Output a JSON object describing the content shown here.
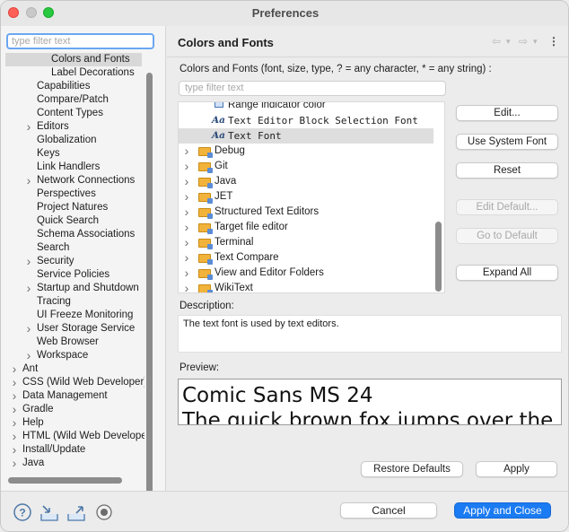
{
  "window": {
    "title": "Preferences"
  },
  "sidebar": {
    "filter_placeholder": "type filter text",
    "items": [
      {
        "label": "Colors and Fonts",
        "level": 3,
        "expandable": false,
        "selected": true
      },
      {
        "label": "Label Decorations",
        "level": 3,
        "expandable": false
      },
      {
        "label": "Capabilities",
        "level": 2,
        "expandable": false
      },
      {
        "label": "Compare/Patch",
        "level": 2,
        "expandable": false
      },
      {
        "label": "Content Types",
        "level": 2,
        "expandable": false
      },
      {
        "label": "Editors",
        "level": 2,
        "expandable": true
      },
      {
        "label": "Globalization",
        "level": 2,
        "expandable": false
      },
      {
        "label": "Keys",
        "level": 2,
        "expandable": false
      },
      {
        "label": "Link Handlers",
        "level": 2,
        "expandable": false
      },
      {
        "label": "Network Connections",
        "level": 2,
        "expandable": true
      },
      {
        "label": "Perspectives",
        "level": 2,
        "expandable": false
      },
      {
        "label": "Project Natures",
        "level": 2,
        "expandable": false
      },
      {
        "label": "Quick Search",
        "level": 2,
        "expandable": false
      },
      {
        "label": "Schema Associations",
        "level": 2,
        "expandable": false
      },
      {
        "label": "Search",
        "level": 2,
        "expandable": false
      },
      {
        "label": "Security",
        "level": 2,
        "expandable": true
      },
      {
        "label": "Service Policies",
        "level": 2,
        "expandable": false
      },
      {
        "label": "Startup and Shutdown",
        "level": 2,
        "expandable": true
      },
      {
        "label": "Tracing",
        "level": 2,
        "expandable": false
      },
      {
        "label": "UI Freeze Monitoring",
        "level": 2,
        "expandable": false
      },
      {
        "label": "User Storage Service",
        "level": 2,
        "expandable": true
      },
      {
        "label": "Web Browser",
        "level": 2,
        "expandable": false
      },
      {
        "label": "Workspace",
        "level": 2,
        "expandable": true
      },
      {
        "label": "Ant",
        "level": 1,
        "expandable": true
      },
      {
        "label": "CSS (Wild Web Developer)",
        "level": 1,
        "expandable": true
      },
      {
        "label": "Data Management",
        "level": 1,
        "expandable": true
      },
      {
        "label": "Gradle",
        "level": 1,
        "expandable": true
      },
      {
        "label": "Help",
        "level": 1,
        "expandable": true
      },
      {
        "label": "HTML (Wild Web Developer)",
        "level": 1,
        "expandable": true
      },
      {
        "label": "Install/Update",
        "level": 1,
        "expandable": true
      },
      {
        "label": "Java",
        "level": 1,
        "expandable": true
      }
    ]
  },
  "main": {
    "title": "Colors and Fonts",
    "nav": {
      "back": "⇦",
      "back_menu": "▾",
      "forward": "⇨",
      "forward_menu": "▾",
      "more": "⋮"
    },
    "instructions": "Colors and Fonts (font, size, type, ? = any character, * = any string) :",
    "filter_placeholder": "type filter text",
    "font_items": [
      {
        "label": "Range indicator color",
        "kind": "color"
      },
      {
        "label": "Text Editor Block Selection Font",
        "kind": "font"
      },
      {
        "label": "Text Font",
        "kind": "font",
        "selected": true
      },
      {
        "label": "Debug",
        "kind": "category"
      },
      {
        "label": "Git",
        "kind": "category"
      },
      {
        "label": "Java",
        "kind": "category"
      },
      {
        "label": "JET",
        "kind": "category"
      },
      {
        "label": "Structured Text Editors",
        "kind": "category"
      },
      {
        "label": "Target file editor",
        "kind": "category"
      },
      {
        "label": "Terminal",
        "kind": "category"
      },
      {
        "label": "Text Compare",
        "kind": "category"
      },
      {
        "label": "View and Editor Folders",
        "kind": "category"
      },
      {
        "label": "WikiText",
        "kind": "category"
      }
    ],
    "font_glyph": "Aa",
    "buttons": {
      "edit": "Edit...",
      "use_system_font": "Use System Font",
      "reset": "Reset",
      "edit_default": "Edit Default...",
      "go_to_default": "Go to Default",
      "expand_all": "Expand All"
    },
    "description_label": "Description:",
    "description_text": "The text font is used by text editors.",
    "preview_label": "Preview:",
    "preview_line1": "Comic Sans MS 24",
    "preview_line2": "The quick brown fox jumps over the lazy dog.",
    "restore_defaults": "Restore Defaults",
    "apply": "Apply"
  },
  "footer": {
    "cancel": "Cancel",
    "apply_and_close": "Apply and Close",
    "icons": [
      "help-icon",
      "import-icon",
      "export-icon",
      "record-icon"
    ]
  },
  "colors": {
    "accent": "#1a7bf2",
    "focus_ring": "#6aa7f2",
    "folder": "#f2b33d"
  }
}
